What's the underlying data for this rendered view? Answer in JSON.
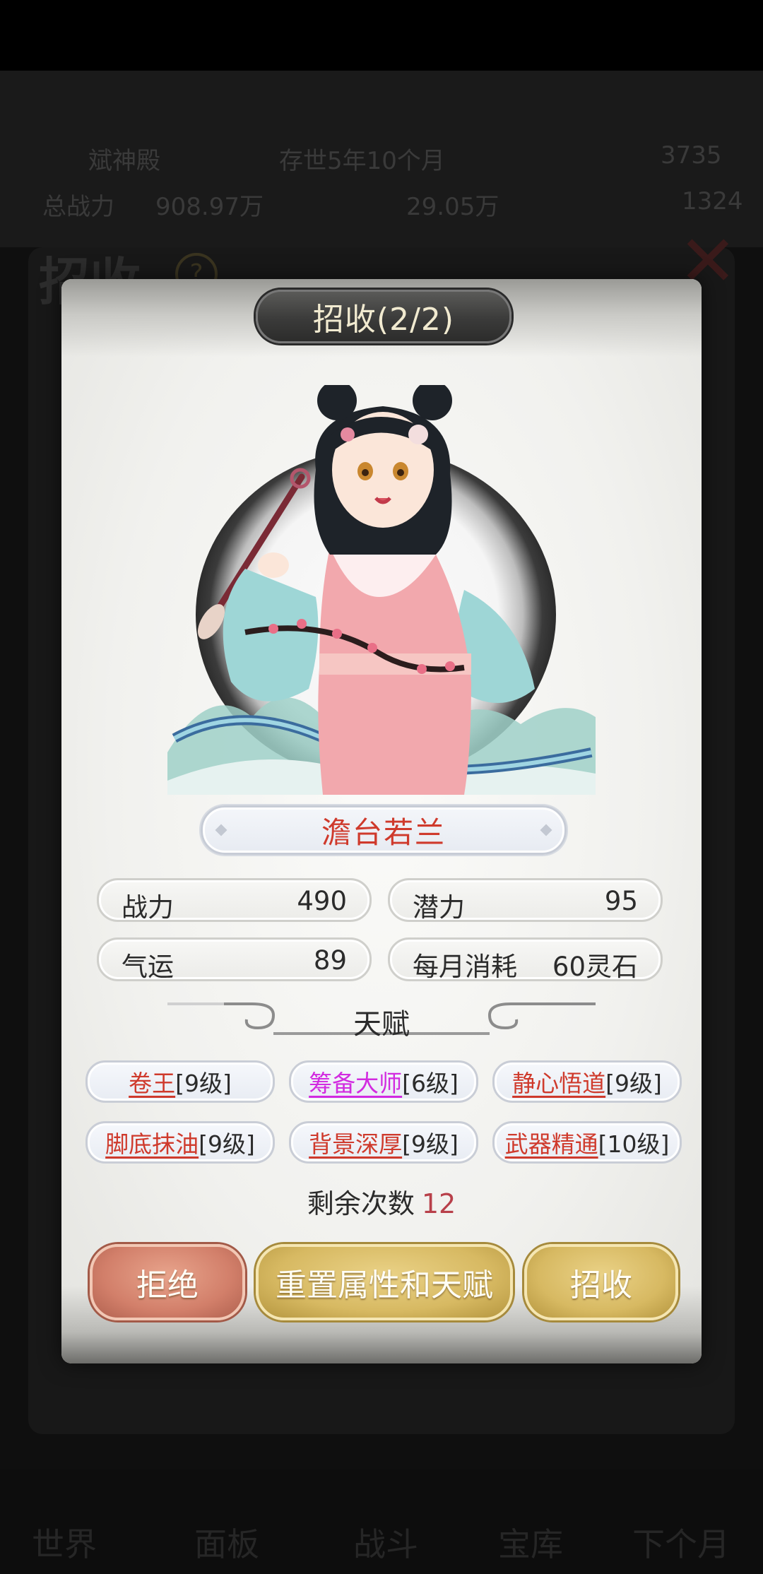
{
  "background": {
    "location": "斌神殿",
    "age": "存世5年10个月",
    "spirit_stone_value": "3735",
    "total_power_label": "总战力",
    "total_power_value": "908.97万",
    "resource_value": "29.05万",
    "other_value": "1324",
    "screen_title": "招收",
    "nav": [
      "世界",
      "面板",
      "战斗",
      "宝库",
      "下个月"
    ]
  },
  "dialog": {
    "title": "招收(2/2)",
    "name": "澹台若兰",
    "stats": [
      {
        "label": "战力",
        "value": "490"
      },
      {
        "label": "潜力",
        "value": "95"
      },
      {
        "label": "气运",
        "value": "89"
      },
      {
        "label": "每月消耗",
        "value": "60灵石"
      }
    ],
    "talent_header": "天赋",
    "talents": [
      {
        "name": "卷王",
        "level": "[9级]",
        "color": "#cf3a2c"
      },
      {
        "name": "筹备大师",
        "level": "[6级]",
        "color": "#d22be0"
      },
      {
        "name": "静心悟道",
        "level": "[9级]",
        "color": "#cf3a2c"
      },
      {
        "name": "脚底抹油",
        "level": "[9级]",
        "color": "#cf3a2c"
      },
      {
        "name": "背景深厚",
        "level": "[9级]",
        "color": "#cf3a2c"
      },
      {
        "name": "武器精通",
        "level": "[10级]",
        "color": "#cf3a2c"
      }
    ],
    "remaining_label": "剩余次数",
    "remaining_count": "12",
    "buttons": {
      "reject": "拒绝",
      "reset": "重置属性和天赋",
      "recruit": "招收"
    }
  }
}
